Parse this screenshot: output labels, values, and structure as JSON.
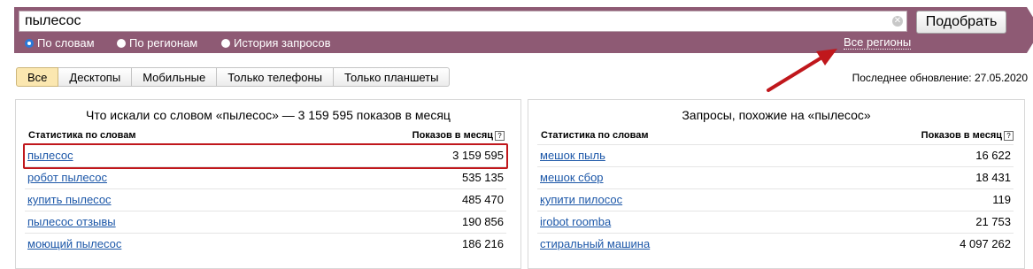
{
  "search": {
    "query": "пылесос",
    "submit_label": "Подобрать"
  },
  "modes": [
    {
      "label": "По словам",
      "selected": true
    },
    {
      "label": "По регионам",
      "selected": false
    },
    {
      "label": "История запросов",
      "selected": false
    }
  ],
  "regions_link": "Все регионы",
  "device_tabs": [
    "Все",
    "Десктопы",
    "Мобильные",
    "Только телефоны",
    "Только планшеты"
  ],
  "active_tab": "Все",
  "last_update": "Последнее обновление: 27.05.2020",
  "left_panel": {
    "title": "Что искали со словом «пылесос» — 3 159 595 показов в месяц",
    "col_words": "Статистика по словам",
    "col_shows": "Показов в месяц",
    "rows": [
      {
        "keyword": "пылесос",
        "shows": "3 159 595"
      },
      {
        "keyword": "робот пылесос",
        "shows": "535 135"
      },
      {
        "keyword": "купить пылесос",
        "shows": "485 470"
      },
      {
        "keyword": "пылесос отзывы",
        "shows": "190 856"
      },
      {
        "keyword": "моющий пылесос",
        "shows": "186 216"
      }
    ]
  },
  "right_panel": {
    "title": "Запросы, похожие на «пылесос»",
    "col_words": "Статистика по словам",
    "col_shows": "Показов в месяц",
    "rows": [
      {
        "keyword": "мешок пыль",
        "shows": "16 622"
      },
      {
        "keyword": "мешок сбор",
        "shows": "18 431"
      },
      {
        "keyword": "купити пилосос",
        "shows": "119"
      },
      {
        "keyword": "irobot roomba",
        "shows": "21 753"
      },
      {
        "keyword": "стиральный машина",
        "shows": "4 097 262"
      }
    ]
  },
  "colors": {
    "header_bg": "#8e5a74",
    "link": "#1c57a8",
    "highlight": "#c0171c",
    "active_tab": "#fbe7b0"
  },
  "icons": {
    "clear": "clear-icon",
    "help": "help-icon",
    "arrow": "annotation-arrow"
  }
}
